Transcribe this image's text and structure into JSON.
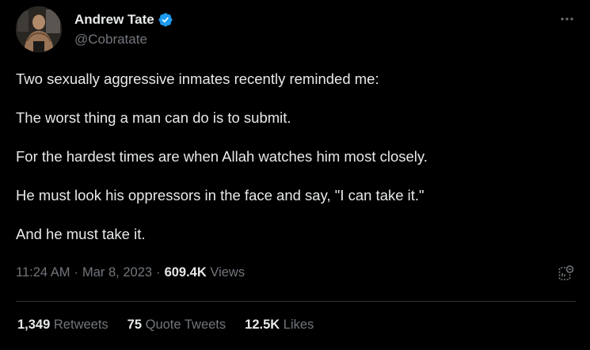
{
  "author": {
    "display_name": "Andrew Tate",
    "handle": "@Cobratate",
    "verified": true
  },
  "icons": {
    "avatar": "profile-photo",
    "verified": "verified-badge-icon",
    "more": "more-options-icon",
    "analytics": "view-analytics-icon"
  },
  "colors": {
    "background": "#000000",
    "text_primary": "#e7e9ea",
    "text_secondary": "#71767b",
    "verified_blue": "#1d9bf0",
    "divider": "#2f3336"
  },
  "tweet": {
    "paragraphs": [
      "Two sexually aggressive inmates recently reminded me:",
      "The worst thing a man can do is to submit.",
      "For the hardest times are when Allah watches him most closely.",
      "He must look his oppressors in the face and say, \"I can take it.\"",
      "And he must take it."
    ],
    "time": "11:24 AM",
    "date": "Mar 8, 2023",
    "views_count": "609.4K",
    "views_label": "Views"
  },
  "stats": {
    "retweets_count": "1,349",
    "retweets_label": "Retweets",
    "quotes_count": "75",
    "quotes_label": "Quote Tweets",
    "likes_count": "12.5K",
    "likes_label": "Likes"
  }
}
